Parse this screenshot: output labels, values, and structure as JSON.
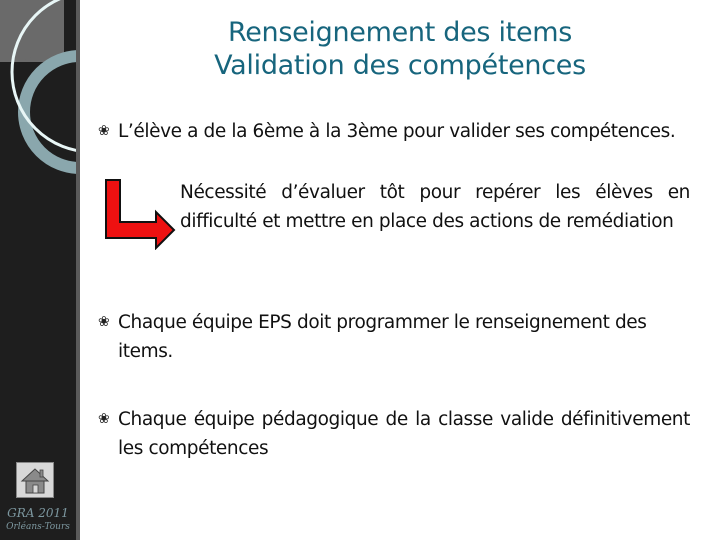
{
  "sidebar": {
    "org_label": "GRA 2011",
    "city_label": "Orléans-Tours",
    "home_icon": "home-icon"
  },
  "title": {
    "line1": "Renseignement des items",
    "line2": "Validation des compétences"
  },
  "bullet_glyph": "❀",
  "bullets": [
    {
      "text": "L’élève a de la 6ème à la 3ème pour valider ses compétences."
    },
    {
      "text": "Chaque équipe EPS doit programmer le renseignement des items."
    },
    {
      "text": "Chaque équipe pédagogique de la classe valide définitivement les compétences"
    }
  ],
  "sub_point": {
    "icon": "red-bent-arrow-icon",
    "text": "Nécessité d’évaluer tôt pour repérer les élèves en difficulté et mettre en place des actions de remédiation"
  },
  "colors": {
    "title": "#17657d",
    "sidebar": "#1e1e1e",
    "accent_ring": "#8aa7ad",
    "arrow": "#ee1111"
  }
}
